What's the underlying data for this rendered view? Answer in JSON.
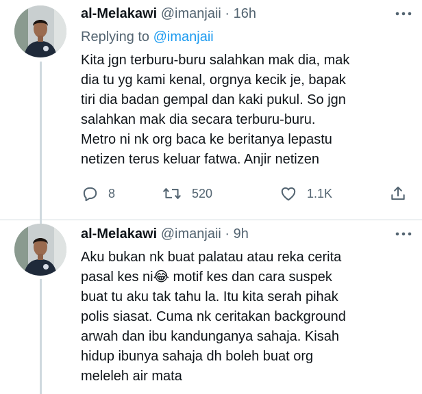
{
  "tweets": [
    {
      "name": "al-Melakawi",
      "handle": "@imanjaii",
      "separator": "·",
      "time": "16h",
      "more_icon": "more-horizontal-icon",
      "replying_prefix": "Replying to",
      "replying_mention": "@imanjaii",
      "text": "Kita jgn terburu-buru salahkan mak dia, mak\ndia tu yg kami kenal, orgnya kecik je, bapak\ntiri dia badan gempal dan kaki pukul. So jgn\nsalahkan mak dia secara terburu-buru.\nMetro ni nk org baca ke beritanya lepastu\nnetizen terus keluar fatwa. Anjir netizen",
      "replies": "8",
      "retweets": "520",
      "likes": "1.1K"
    },
    {
      "name": "al-Melakawi",
      "handle": "@imanjaii",
      "separator": "·",
      "time": "9h",
      "more_icon": "more-horizontal-icon",
      "text": "Aku bukan nk buat palatau atau reka cerita\npasal kes ni😂 motif kes dan cara suspek\nbuat tu aku tak tahu la. Itu kita serah pihak\npolis siasat. Cuma nk ceritakan background\narwah dan ibu kandunganya sahaja. Kisah\nhidup ibunya sahaja dh boleh buat org\nmeleleh air mata"
    }
  ],
  "colors": {
    "text": "#0f1419",
    "secondary": "#536471",
    "link": "#1d9bf0",
    "thread_line": "#cfd9de"
  }
}
